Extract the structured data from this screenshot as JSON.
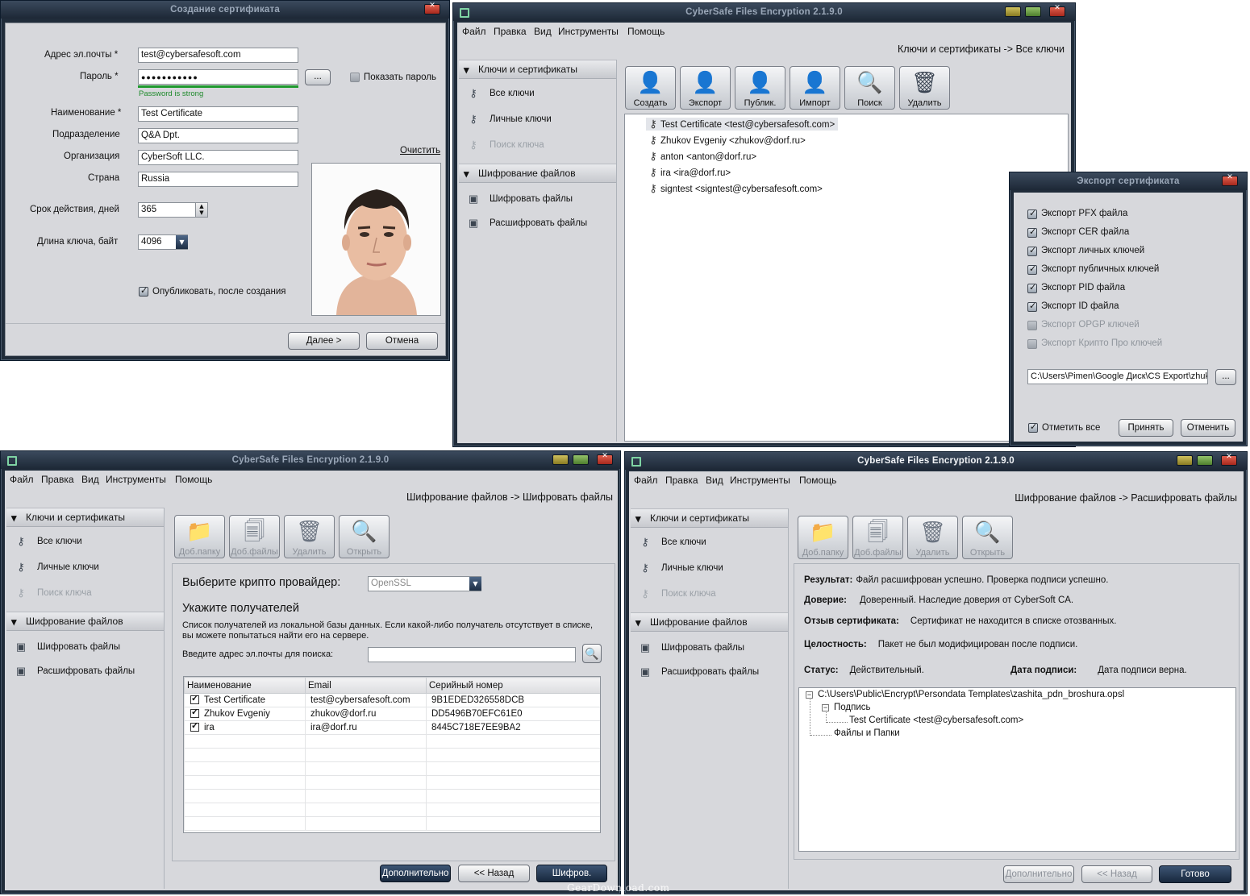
{
  "cert_dialog": {
    "title": "Создание сертификата",
    "email_label": "Адрес эл.почты *",
    "email_value": "test@cybersafesoft.com",
    "password_label": "Пароль *",
    "password_value": "●●●●●●●●●●●",
    "browse_label": "...",
    "show_password_label": "Показать пароль",
    "password_hint": "Password is strong",
    "name_label": "Наименование *",
    "name_value": "Test Certificate",
    "department_label": "Подразделение",
    "department_value": "Q&A Dpt.",
    "org_label": "Организация",
    "org_value": "CyberSoft LLC.",
    "country_label": "Страна",
    "country_value": "Russia",
    "clear_link": "Очистить",
    "validity_label": "Срок действия, дней",
    "validity_value": "365",
    "keylen_label": "Длина ключа, байт",
    "keylen_value": "4096",
    "publish_label": "Опубликовать, после создания",
    "next_button": "Далее >",
    "cancel_button": "Отмена"
  },
  "main_window": {
    "title": "CyberSafe Files Encryption 2.1.9.0",
    "menu": [
      "Файл",
      "Правка",
      "Вид",
      "Инструменты",
      "Помощь"
    ],
    "breadcrumb": "Ключи и сертификаты -> Все ключи",
    "sidebar": {
      "section1": "Ключи и сертификаты",
      "all_keys": "Все ключи",
      "personal_keys": "Личные ключи",
      "find_key": "Поиск ключа",
      "section2": "Шифрование файлов",
      "encrypt_files": "Шифровать файлы",
      "decrypt_files": "Расшифровать файлы"
    },
    "toolbar": [
      "Создать",
      "Экспорт",
      "Публик.",
      "Импорт",
      "Поиск",
      "Удалить"
    ],
    "keys": [
      "Test Certificate <test@cybersafesoft.com>",
      "Zhukov Evgeniy <zhukov@dorf.ru>",
      "anton <anton@dorf.ru>",
      "ira <ira@dorf.ru>",
      "signtest <signtest@cybersafesoft.com>"
    ]
  },
  "export_dialog": {
    "title": "Экспорт сертификата",
    "options": [
      "Экспорт PFX файла",
      "Экспорт CER файла",
      "Экспорт личных ключей",
      "Экспорт публичных ключей",
      "Экспорт PID файла",
      "Экспорт ID файла",
      "Экспорт OPGP ключей",
      "Экспорт Крипто Про ключей"
    ],
    "path_value": "C:\\Users\\Pimen\\Google Диск\\CS Export\\zhuko",
    "browse_label": "...",
    "select_all": "Отметить все",
    "accept_button": "Принять",
    "cancel_button": "Отменить"
  },
  "encrypt_window": {
    "title": "CyberSafe Files Encryption 2.1.9.0",
    "breadcrumb": "Шифрование файлов -> Шифровать файлы",
    "toolbar": [
      "Доб.папку",
      "Доб.файлы",
      "Удалить",
      "Открыть"
    ],
    "provider_label": "Выберите крипто провайдер:",
    "provider_value": "OpenSSL",
    "recipients_heading": "Укажите получателей",
    "recipients_desc_1": "Список получателей из локальной базы данных. Если какой-либо получатель отсутствует в списке,",
    "recipients_desc_2": "вы можете попытаться найти его на сервере.",
    "search_label": "Введите адрес эл.почты для поиска:",
    "columns": [
      "Наименование",
      "Email",
      "Серийный номер"
    ],
    "rows": [
      [
        "Test Certificate",
        "test@cybersafesoft.com",
        "9B1EDED326558DCB"
      ],
      [
        "Zhukov Evgeniy",
        "zhukov@dorf.ru",
        "DD5496B70EFC61E0"
      ],
      [
        "ira",
        "ira@dorf.ru",
        "8445C718E7EE9BA2"
      ]
    ],
    "more_button": "Дополнительно",
    "back_button": "<< Назад",
    "encrypt_button": "Шифров."
  },
  "decrypt_window": {
    "title": "CyberSafe Files Encryption 2.1.9.0",
    "breadcrumb": "Шифрование файлов -> Расшифровать файлы",
    "toolbar": [
      "Доб.папку",
      "Доб.файлы",
      "Удалить",
      "Открыть"
    ],
    "result_label": "Результат:",
    "result_value": "Файл расшифрован успешно. Проверка подписи успешно.",
    "trust_label": "Доверие:",
    "trust_value": "Доверенный. Наследие доверия от CyberSoft CA.",
    "revoke_label": "Отзыв сертификата:",
    "revoke_value": "Сертификат не находится в списке отозванных.",
    "integrity_label": "Целостность:",
    "integrity_value": "Пакет не был модифицирован после подписи.",
    "status_label": "Статус:",
    "status_value": "Действительный.",
    "sign_date_label": "Дата подписи:",
    "sign_date_value": "Дата подписи верна.",
    "tree_root": "C:\\Users\\Public\\Encrypt\\Persondata Templates\\zashita_pdn_broshura.opsl",
    "tree_signature": "Подпись",
    "tree_cert": "Test Certificate <test@cybersafesoft.com>",
    "tree_files": "Файлы и Папки",
    "more_button": "Дополнительно",
    "back_button": "<< Назад",
    "done_button": "Готово"
  },
  "watermark": "GearDownload.com"
}
